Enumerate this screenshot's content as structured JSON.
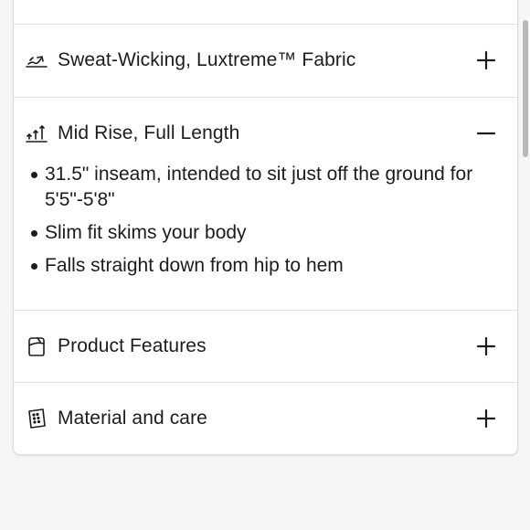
{
  "accordion": {
    "items": [
      {
        "label": "Sweat-Wicking, Luxtreme™ Fabric",
        "icon": "sweat-wicking-icon",
        "state": "collapsed"
      },
      {
        "label": "Mid Rise, Full Length",
        "icon": "rise-length-icon",
        "state": "expanded",
        "details": [
          "31.5\" inseam, intended to sit just off the ground for 5'5\"-5'8\"",
          "Slim fit skims your body",
          "Falls straight down from hip to hem"
        ]
      },
      {
        "label": "Product Features",
        "icon": "product-features-icon",
        "state": "collapsed"
      },
      {
        "label": "Material and care",
        "icon": "material-care-icon",
        "state": "collapsed"
      }
    ]
  },
  "colors": {
    "text": "#1c1c1c",
    "background": "#f6f6f6",
    "card": "#ffffff",
    "divider": "#e3e3e3"
  }
}
